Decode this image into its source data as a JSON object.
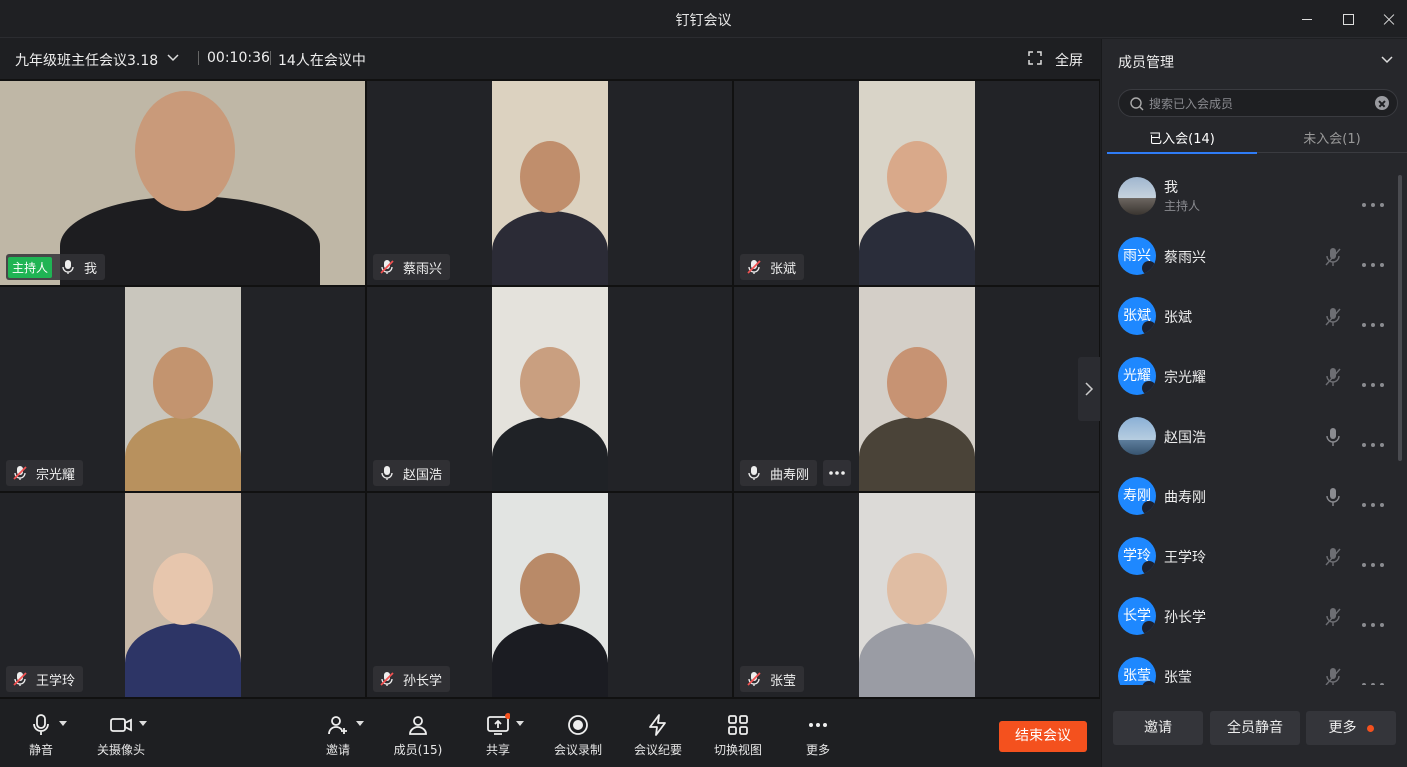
{
  "window": {
    "title": "钉钉会议"
  },
  "meeting": {
    "title": "九年级班主任会议3.18",
    "elapsed": "00:10:36",
    "participants_text": "14人在会议中",
    "fullscreen_label": "全屏"
  },
  "tiles": [
    {
      "name": "我",
      "host_badge": "主持人",
      "mic": "on",
      "colors": {
        "bg": "#bfb7a6",
        "skin": "#c99a7a",
        "shirt": "#1d1d20"
      }
    },
    {
      "name": "蔡雨兴",
      "mic": "muted",
      "colors": {
        "bg": "#dcd2c0",
        "skin": "#c08e6c",
        "shirt": "#2b2b36"
      }
    },
    {
      "name": "张斌",
      "mic": "muted",
      "colors": {
        "bg": "#d9d4c8",
        "skin": "#d9a98a",
        "shirt": "#2a2d3a"
      }
    },
    {
      "name": "宗光耀",
      "mic": "muted",
      "colors": {
        "bg": "#c9c6bd",
        "skin": "#c3946f",
        "shirt": "#b8915e"
      }
    },
    {
      "name": "赵国浩",
      "mic": "on",
      "colors": {
        "bg": "#e4e2dc",
        "skin": "#c99f80",
        "shirt": "#1f2226"
      }
    },
    {
      "name": "曲寿刚",
      "mic": "on",
      "more": true,
      "colors": {
        "bg": "#d4cfc8",
        "skin": "#c79373",
        "shirt": "#4a4338"
      }
    },
    {
      "name": "王学玲",
      "mic": "muted",
      "colors": {
        "bg": "#c8b9a8",
        "skin": "#e7c6ad",
        "shirt": "#2d3566"
      }
    },
    {
      "name": "孙长学",
      "mic": "muted",
      "colors": {
        "bg": "#e2e4e2",
        "skin": "#b98a68",
        "shirt": "#1b1c22"
      }
    },
    {
      "name": "张莹",
      "mic": "muted",
      "colors": {
        "bg": "#dcdad7",
        "skin": "#e0bda3",
        "shirt": "#9a9ca4"
      }
    }
  ],
  "toolbar": {
    "mute": "静音",
    "camera_off": "关摄像头",
    "invite": "邀请",
    "members": "成员(15)",
    "share": "共享",
    "record": "会议录制",
    "minutes": "会议纪要",
    "switch_view": "切换视图",
    "more": "更多",
    "end": "结束会议"
  },
  "panel": {
    "title": "成员管理",
    "search_placeholder": "搜索已入会成员",
    "tab_joined": "已入会(14)",
    "tab_not_joined": "未入会(1)",
    "members": [
      {
        "avatar": "",
        "name": "我",
        "role": "主持人",
        "mic": "none",
        "photo": true
      },
      {
        "avatar": "雨兴",
        "name": "蔡雨兴",
        "mic": "muted"
      },
      {
        "avatar": "张斌",
        "name": "张斌",
        "mic": "muted"
      },
      {
        "avatar": "光耀",
        "name": "宗光耀",
        "mic": "muted"
      },
      {
        "avatar": "",
        "name": "赵国浩",
        "mic": "on",
        "photo": true
      },
      {
        "avatar": "寿刚",
        "name": "曲寿刚",
        "mic": "on"
      },
      {
        "avatar": "学玲",
        "name": "王学玲",
        "mic": "muted"
      },
      {
        "avatar": "长学",
        "name": "孙长学",
        "mic": "muted"
      },
      {
        "avatar": "张莹",
        "name": "张莹",
        "mic": "muted"
      }
    ],
    "invite": "邀请",
    "mute_all": "全员静音",
    "more": "更多"
  },
  "colors": {
    "accent_blue": "#1e88ff",
    "end_red": "#f4511e",
    "host_green": "#1fb454"
  }
}
